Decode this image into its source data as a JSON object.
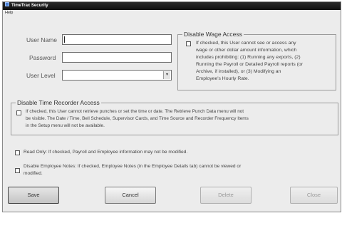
{
  "window": {
    "title": "TimeTrax Security"
  },
  "menubar": {
    "help": "Help"
  },
  "form": {
    "user_name_label": "User Name",
    "password_label": "Password",
    "user_level_label": "User Level",
    "user_name_value": "",
    "password_value": "",
    "user_level_value": ""
  },
  "wage_group": {
    "title": "Disable Wage Access",
    "lines": [
      "If checked, this User cannot see or access any",
      "wage or other dollar amount information, which",
      "includes prohibiting: (1) Running any exports, (2)",
      "Running the Payroll or Detailed Payroll reports (or",
      "Archive, if installed), or (3) Modifying an",
      "Employee's Hourly Rate."
    ]
  },
  "time_group": {
    "title": "Disable Time Recorder Access",
    "lines": [
      "If checked, this User cannot retrieve punches or set the time or date. The Retrieve Punch Data menu will not",
      "be visible. The Date / Time, Bell Schedule, Supervisor Cards, and Time Source and Recorder Frequency Items",
      "in the Setup menu will not be available."
    ]
  },
  "read_only": {
    "text": "Read Only: If checked, Payroll and Employee information may not be modified."
  },
  "notes": {
    "lines": [
      "Disable Employee Notes: If checked, Employee Notes (in the Employee Details tab) cannot be viewed or",
      "modified."
    ]
  },
  "buttons": {
    "save": "Save",
    "cancel": "Cancel",
    "delete": "Delete",
    "close": "Close"
  },
  "icons": {
    "dropdown": "chevron-down-icon",
    "app": "app-icon"
  }
}
